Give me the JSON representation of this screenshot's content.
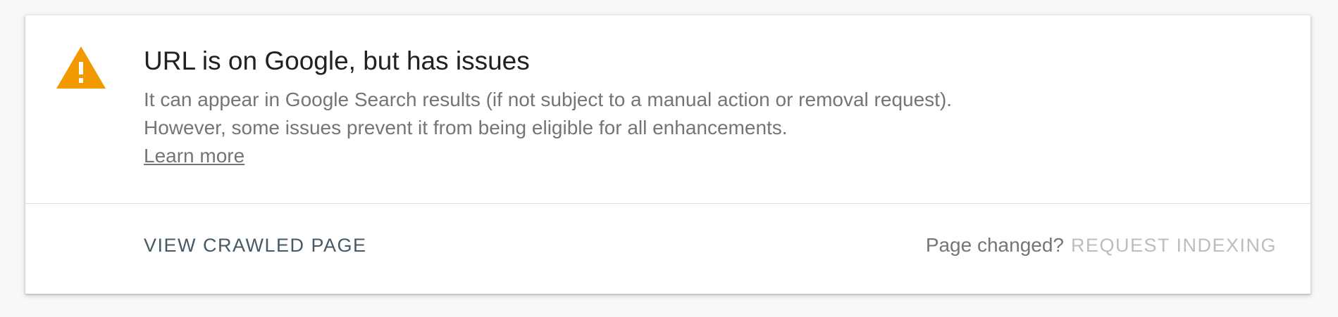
{
  "status": {
    "icon": "warning-triangle-icon",
    "icon_color": "#f29900",
    "title": "URL is on Google, but has issues",
    "description": "It can appear in Google Search results (if not subject to a manual action or removal request). However, some issues prevent it from being eligible for all enhancements.",
    "learn_more_label": "Learn more"
  },
  "actions": {
    "view_crawled_label": "VIEW CRAWLED PAGE",
    "page_changed_text": "Page changed?",
    "request_indexing_label": "REQUEST INDEXING",
    "request_indexing_enabled": false
  }
}
